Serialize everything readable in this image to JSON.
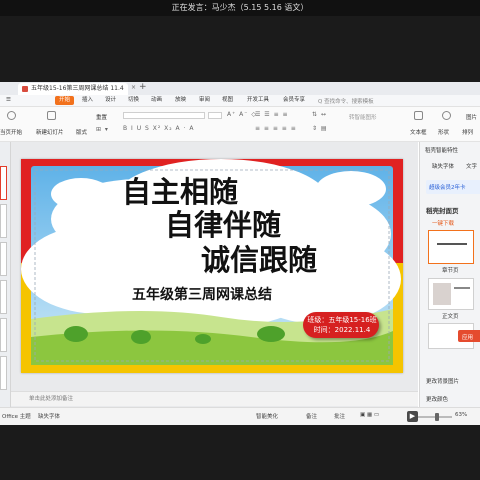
{
  "meeting": {
    "speaking_text": "正在发言：马少杰（5.15 5.16 语文）"
  },
  "tab": {
    "title": "五年级15-16第三周网课总结 11.4",
    "close_glyph": "×",
    "add_glyph": "+"
  },
  "menu": {
    "items": [
      "开始",
      "插入",
      "设计",
      "切换",
      "动画",
      "放映",
      "审阅",
      "视图",
      "开发工具",
      "会员专享"
    ],
    "active": "开始",
    "search_placeholder": "Q 查找命令、搜索模板"
  },
  "ribbon": {
    "play_label": "当页开始",
    "new_slide_label": "新建幻灯片",
    "layout_label": "版式",
    "reset_label": "重置",
    "textbox_label": "文本框",
    "shape_label": "形状",
    "arrange_label": "排列",
    "image_label": "图片",
    "convert_label": "转智能图形"
  },
  "slide": {
    "line1": "自主相随",
    "line2": "自律伴随",
    "line3": "诚信跟随",
    "subtitle": "五年级第三周网课总结",
    "badge_line1": "班级：五年级15-16班",
    "badge_line2": "时间：2022.11.4"
  },
  "notes": {
    "placeholder": "单击此处添加备注"
  },
  "right_panel": {
    "header": "稻壳智能特性",
    "tab_missing_font": "缺失字体",
    "tab_text": "文字",
    "vip_banner": "超级会员2年卡",
    "cover_title": "稻壳封面页",
    "download_label": "一键下载",
    "card1_label": "章节页",
    "card2_label": "正文页",
    "apply_label": "应用",
    "change_bg": "更改背景图片",
    "change_color": "更改颜色"
  },
  "status": {
    "template": "Office 主题",
    "missing_font": "缺失字体",
    "smart_beautify": "智能美化",
    "notes": "备注",
    "comment": "批注",
    "zoom": "63%"
  },
  "colors": {
    "accent": "#f2711c",
    "slide_top_band": "#e02222",
    "slide_bottom_band": "#f5c400",
    "badge": "#d62020"
  }
}
